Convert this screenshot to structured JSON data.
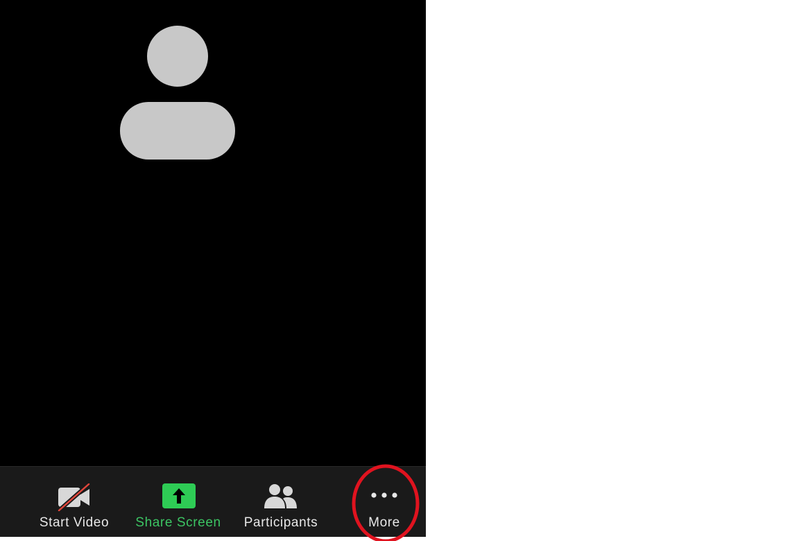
{
  "toolbar": {
    "start_video_label": "Start Video",
    "share_screen_label": "Share Screen",
    "participants_label": "Participants",
    "more_label": "More"
  },
  "colors": {
    "background": "#000000",
    "toolbar": "#1a1a1a",
    "avatar": "#c8c8c8",
    "icon": "#d8d8d8",
    "share_green": "#2ecc55",
    "video_slash": "#e0453a",
    "highlight_ring": "#e0131f"
  },
  "icons": {
    "avatar": "person-silhouette-icon",
    "start_video": "video-off-icon",
    "share_screen": "share-screen-arrow-icon",
    "participants": "participants-icon",
    "more": "more-dots-icon"
  }
}
